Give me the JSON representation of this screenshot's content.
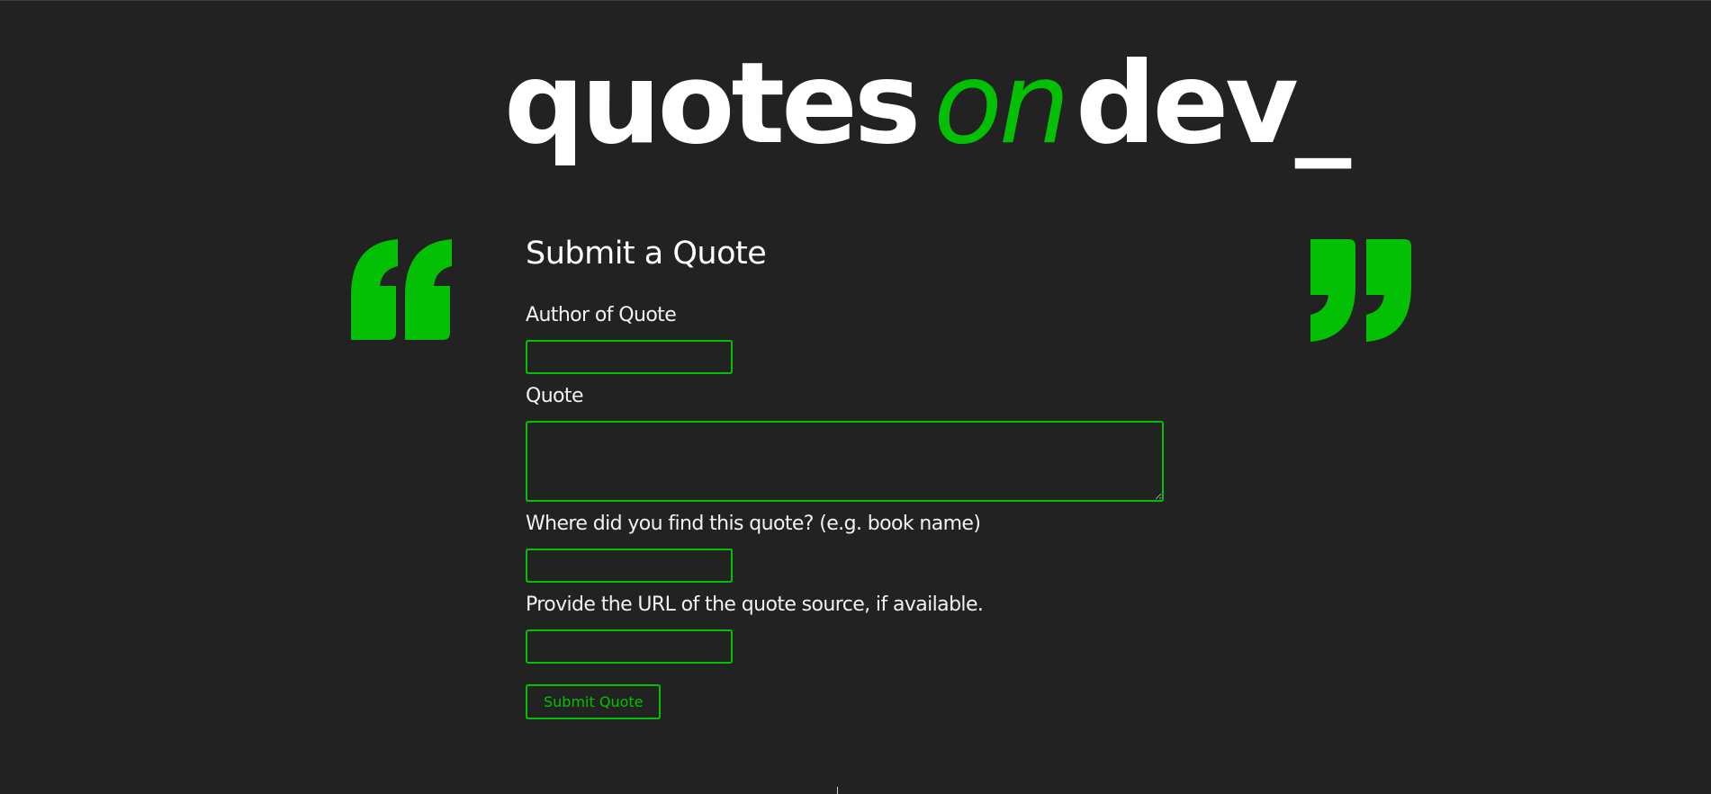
{
  "colors": {
    "background": "#222222",
    "accent": "#04c004",
    "text": "#ffffff"
  },
  "logo": {
    "part1": "quotes",
    "part2": "on",
    "part3": "dev_"
  },
  "decorations": {
    "left_icon": "open-quote-icon",
    "right_icon": "close-quote-icon"
  },
  "form": {
    "title": "Submit a Quote",
    "author_label": "Author of Quote",
    "author_value": "",
    "quote_label": "Quote",
    "quote_value": "",
    "source_label": "Where did you find this quote? (e.g. book name)",
    "source_value": "",
    "url_label": "Provide the URL of the quote source, if available.",
    "url_value": "",
    "submit_label": "Submit Quote"
  }
}
